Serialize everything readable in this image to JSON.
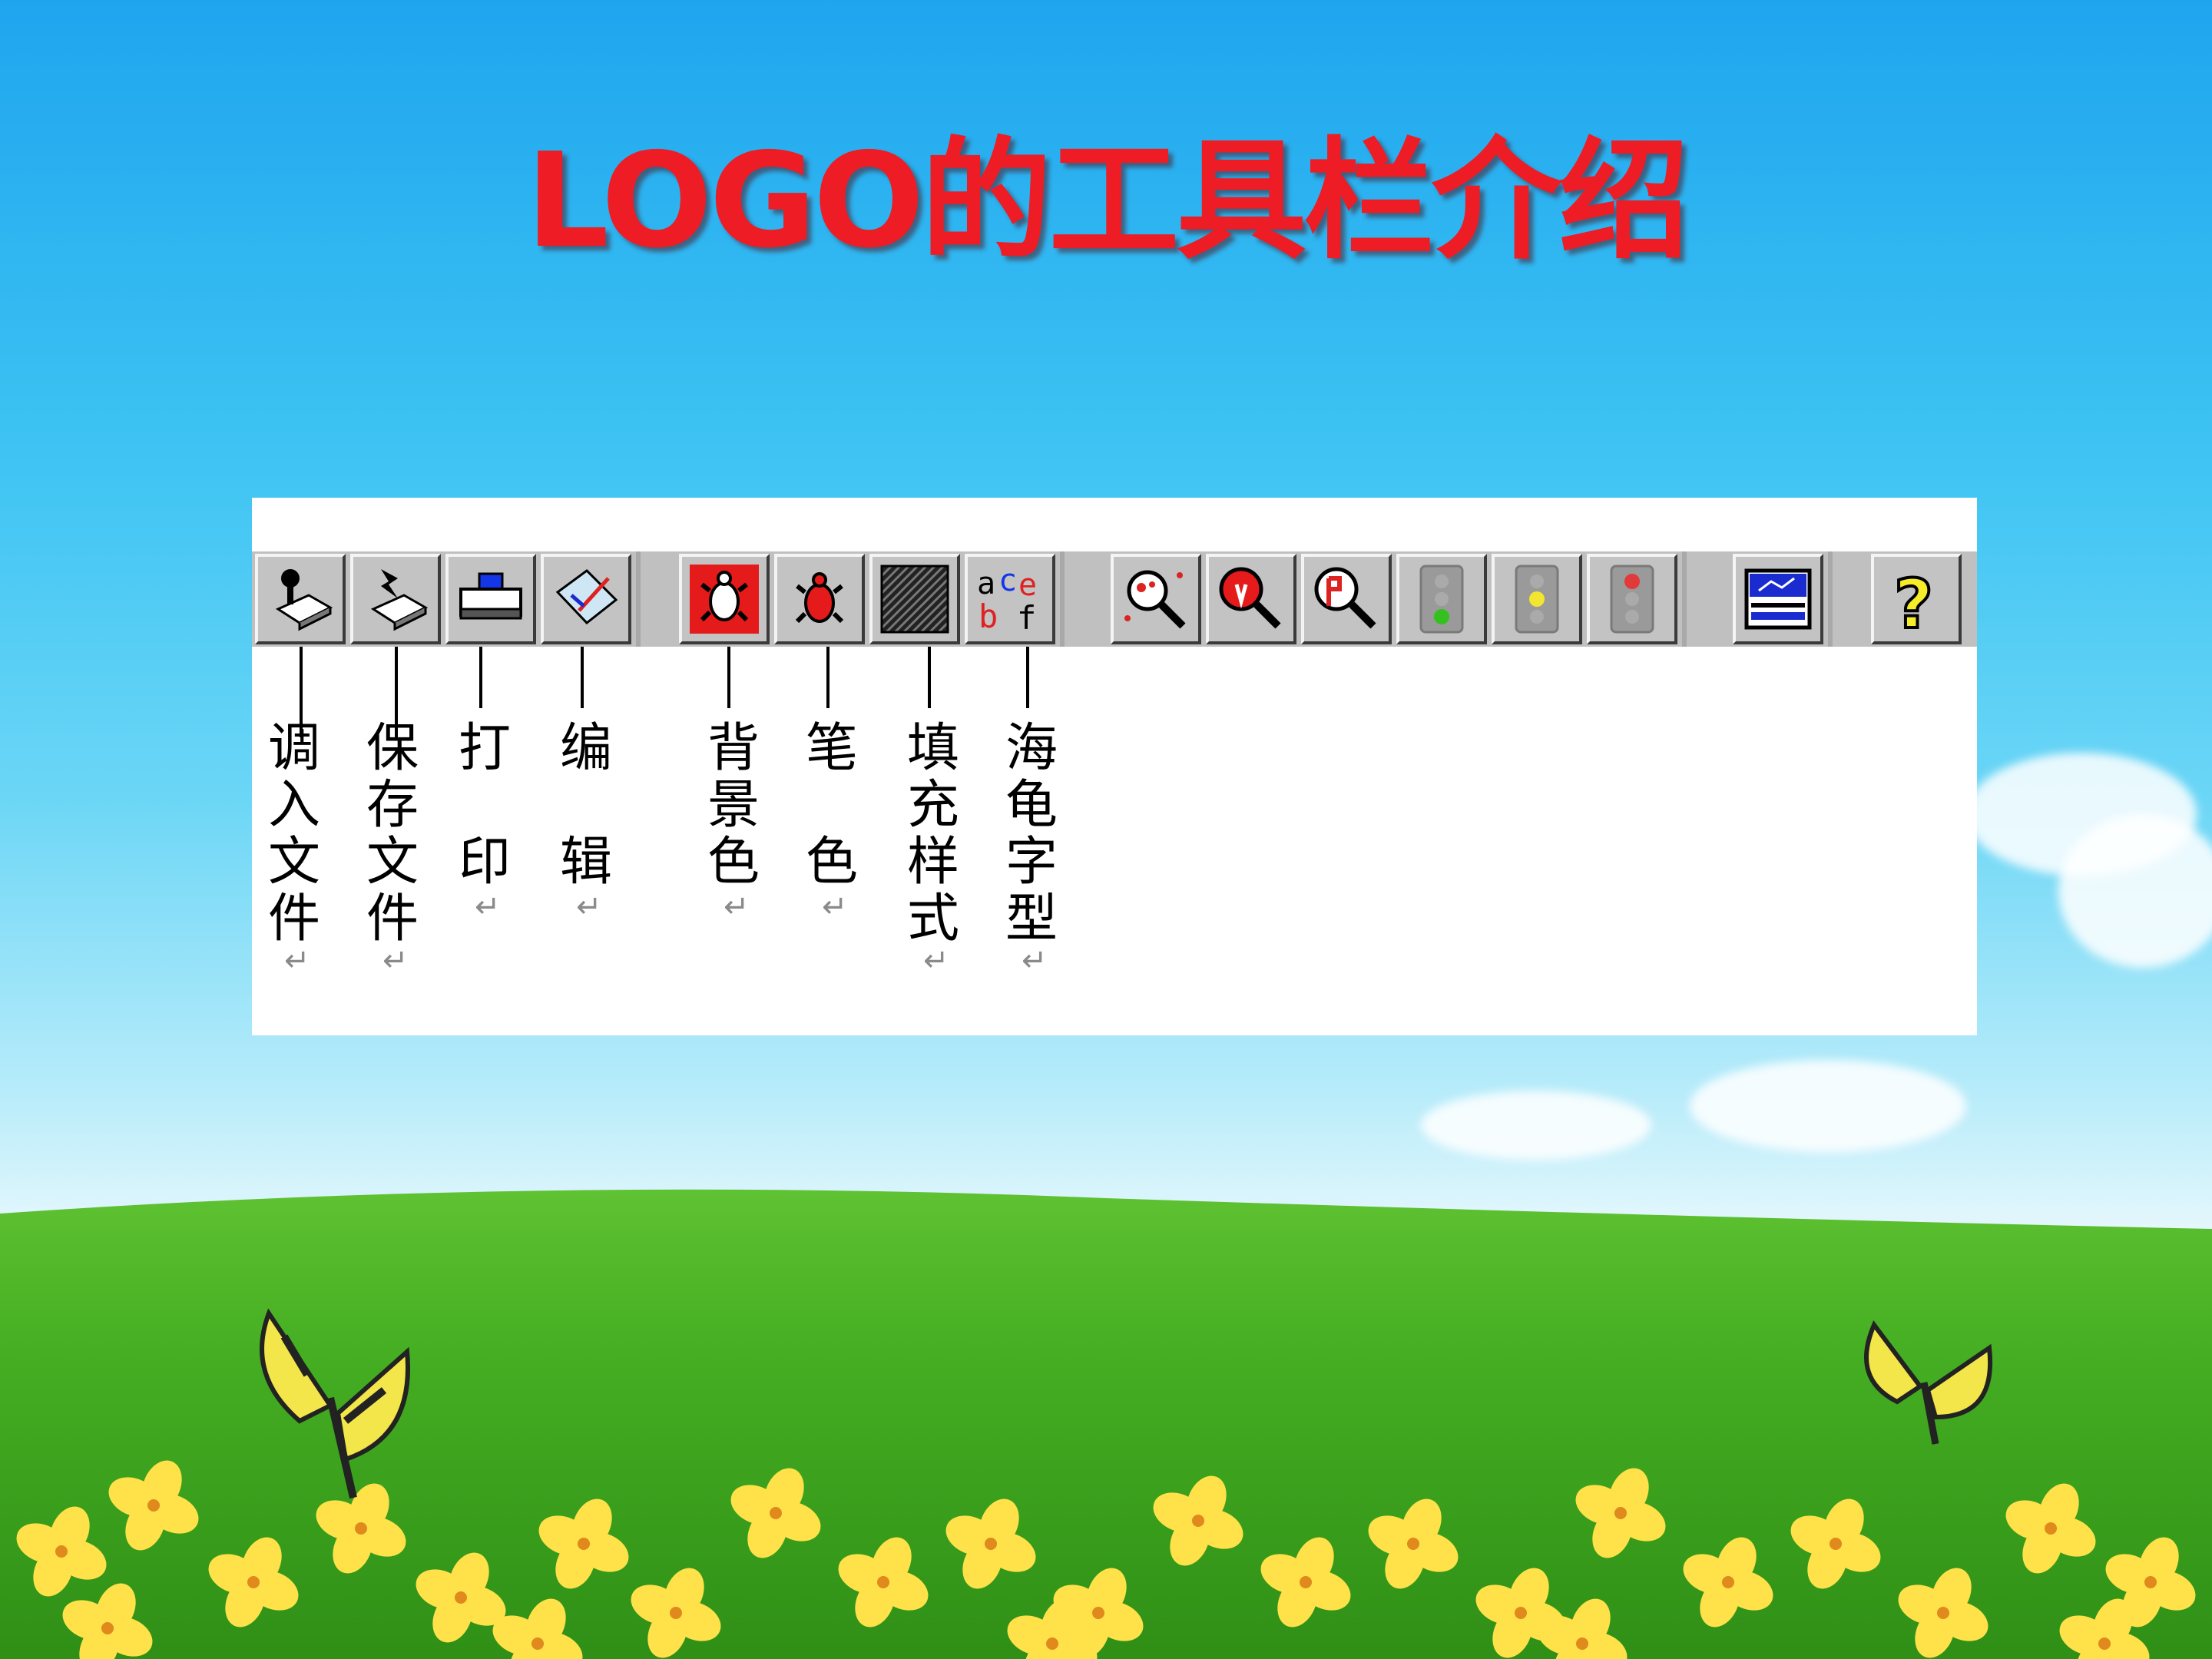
{
  "slide": {
    "title": "LOGO的工具栏介绍"
  },
  "toolbar": {
    "buttons": [
      {
        "icon": "load-file-icon"
      },
      {
        "icon": "save-file-icon"
      },
      {
        "icon": "printer-icon"
      },
      {
        "icon": "edit-icon"
      },
      {
        "icon": "turtle-background-icon"
      },
      {
        "icon": "turtle-pen-icon"
      },
      {
        "icon": "fill-pattern-icon"
      },
      {
        "icon": "turtle-font-icon"
      },
      {
        "icon": "zoom-icon"
      },
      {
        "icon": "zoom-in-icon"
      },
      {
        "icon": "zoom-out-icon"
      },
      {
        "icon": "traffic-light-green-icon"
      },
      {
        "icon": "traffic-light-yellow-icon"
      },
      {
        "icon": "traffic-light-red-icon"
      },
      {
        "icon": "screen-icon"
      },
      {
        "icon": "help-icon"
      }
    ],
    "labels": [
      {
        "text": "调\n入\n文\n件",
        "mark": "↵"
      },
      {
        "text": "保\n存\n文\n件",
        "mark": "↵"
      },
      {
        "text": "打\n\n印",
        "mark": "↵"
      },
      {
        "text": "编\n\n辑",
        "mark": "↵"
      },
      {
        "text": "背\n景\n色",
        "mark": "↵"
      },
      {
        "text": "笔\n\n色",
        "mark": "↵"
      },
      {
        "text": "填\n充\n样\n式",
        "mark": "↵"
      },
      {
        "text": "海\n龟\n字\n型",
        "mark": "↵"
      }
    ]
  },
  "colors": {
    "title": "#ee1c24",
    "sky": "#29b6f0",
    "grass": "#4fb82a",
    "flower": "#ffe14a"
  }
}
